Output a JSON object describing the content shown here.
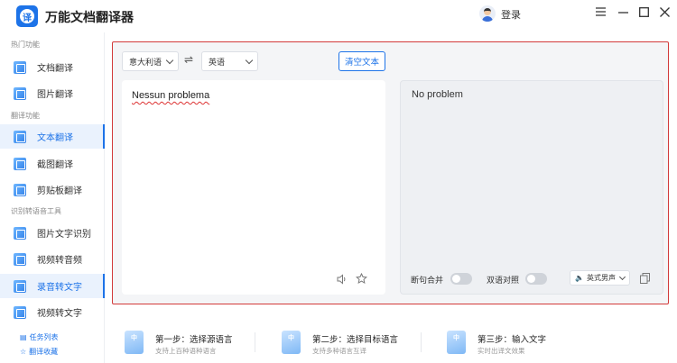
{
  "app": {
    "title": "万能文档翻译器",
    "logo_char": "译",
    "login_label": "登录"
  },
  "window_controls": [
    "menu-icon",
    "minimize-icon",
    "maximize-icon",
    "close-icon"
  ],
  "sidebar": {
    "sections": [
      {
        "label": "热门功能"
      },
      {
        "label": "翻译功能"
      },
      {
        "label": "识别转语音工具"
      }
    ],
    "items": [
      {
        "label": "文档翻译",
        "icon": "document-translate-icon"
      },
      {
        "label": "图片翻译",
        "icon": "image-translate-icon"
      },
      {
        "label": "文本翻译",
        "icon": "text-translate-icon",
        "active": true
      },
      {
        "label": "截图翻译",
        "icon": "screenshot-translate-icon"
      },
      {
        "label": "剪贴板翻译",
        "icon": "clipboard-translate-icon"
      },
      {
        "label": "图片文字识别",
        "icon": "ocr-icon"
      },
      {
        "label": "视频转音频",
        "icon": "video-to-audio-icon"
      },
      {
        "label": "录音转文字",
        "icon": "recording-to-text-icon",
        "active": true
      },
      {
        "label": "视频转文字",
        "icon": "video-to-text-icon"
      }
    ],
    "bottom_links": [
      {
        "label": "任务列表",
        "icon": "list-icon"
      },
      {
        "label": "翻译收藏",
        "icon": "star-icon"
      }
    ]
  },
  "translator": {
    "source_language": "意大利语",
    "target_language": "英语",
    "clear_label": "清空文本",
    "source_text": "Nessun problema",
    "translated_text": "No problem",
    "sentence_merge_label": "断句合并",
    "bilingual_label": "双语对照",
    "sentence_merge_on": false,
    "bilingual_on": false,
    "voice_option": "英式男声"
  },
  "steps": [
    {
      "title": "第一步：选择源语言",
      "desc": "支持上百种语种语言",
      "icon_char": "中"
    },
    {
      "title": "第二步：选择目标语言",
      "desc": "支持多种语言互译",
      "icon_char": "中"
    },
    {
      "title": "第三步：输入文字",
      "desc": "实时出译文效果",
      "icon_char": "中"
    }
  ],
  "colors": {
    "accent": "#1d73e8",
    "highlight_border": "#d23a3a",
    "panel_bg": "#f4f5f7"
  }
}
